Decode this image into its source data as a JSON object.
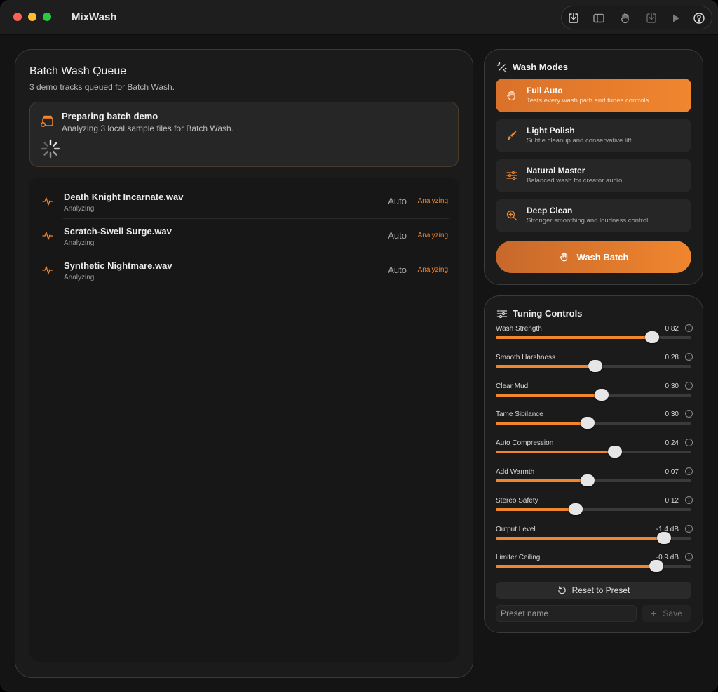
{
  "app": {
    "title": "MixWash"
  },
  "toolbar": {
    "buttons": [
      "import-icon",
      "sidebar-icon",
      "wash-hand-icon",
      "export-icon",
      "play-icon",
      "help-icon"
    ]
  },
  "queue": {
    "title": "Batch Wash Queue",
    "subtitle": "3 demo tracks queued for Batch Wash.",
    "status": {
      "title": "Preparing batch demo",
      "description": "Analyzing 3 local sample files for Batch Wash."
    },
    "tracks": [
      {
        "name": "Death Knight Incarnate.wav",
        "status": "Analyzing",
        "mode": "Auto",
        "badge": "Analyzing"
      },
      {
        "name": "Scratch-Swell Surge.wav",
        "status": "Analyzing",
        "mode": "Auto",
        "badge": "Analyzing"
      },
      {
        "name": "Synthetic Nightmare.wav",
        "status": "Analyzing",
        "mode": "Auto",
        "badge": "Analyzing"
      }
    ]
  },
  "modes": {
    "title": "Wash Modes",
    "items": [
      {
        "name": "Full Auto",
        "description": "Tests every wash path and tunes controls",
        "active": true,
        "icon": "wash-hand-icon"
      },
      {
        "name": "Light Polish",
        "description": "Subtle cleanup and conservative lift",
        "active": false,
        "icon": "brush-icon"
      },
      {
        "name": "Natural Master",
        "description": "Balanced wash for creator audio",
        "active": false,
        "icon": "sliders-icon"
      },
      {
        "name": "Deep Clean",
        "description": "Stronger smoothing and loudness control",
        "active": false,
        "icon": "zoom-in-icon"
      }
    ],
    "wash_button": "Wash Batch"
  },
  "tuning": {
    "title": "Tuning Controls",
    "controls": [
      {
        "label": "Wash Strength",
        "value": "0.82",
        "fraction": 0.8
      },
      {
        "label": "Smooth Harshness",
        "value": "0.28",
        "fraction": 0.51
      },
      {
        "label": "Clear Mud",
        "value": "0.30",
        "fraction": 0.54
      },
      {
        "label": "Tame Sibilance",
        "value": "0.30",
        "fraction": 0.47
      },
      {
        "label": "Auto Compression",
        "value": "0.24",
        "fraction": 0.61
      },
      {
        "label": "Add Warmth",
        "value": "0.07",
        "fraction": 0.47
      },
      {
        "label": "Stereo Safety",
        "value": "0.12",
        "fraction": 0.41
      },
      {
        "label": "Output Level",
        "value": "-1.4 dB",
        "fraction": 0.86
      },
      {
        "label": "Limiter Ceiling",
        "value": "-0.9 dB",
        "fraction": 0.82
      }
    ],
    "reset_label": "Reset to Preset",
    "preset_placeholder": "Preset name",
    "save_label": "Save"
  },
  "colors": {
    "accent": "#f0862e",
    "background": "#141414",
    "panel": "#1b1b1b"
  }
}
